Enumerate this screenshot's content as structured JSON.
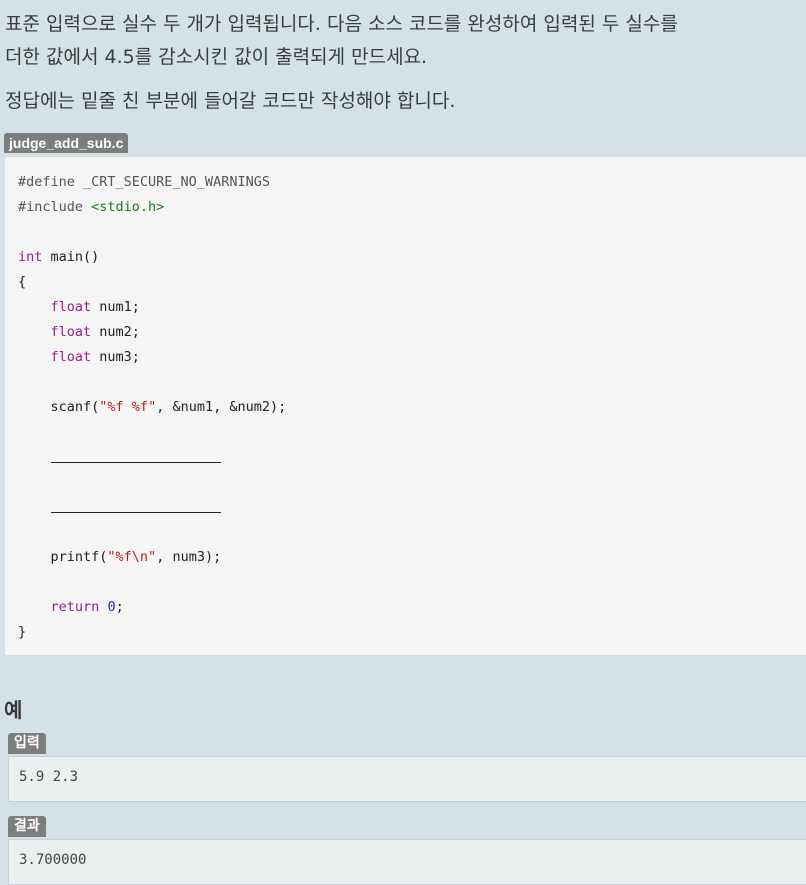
{
  "description": {
    "line1": "표준 입력으로 실수 두 개가 입력됩니다. 다음 소스 코드를 완성하여 입력된 두 실수를",
    "line2": "더한 값에서 4.5를 감소시킨 값이 출력되게 만드세요.",
    "line3": "정답에는 밑줄 친 부분에 들어갈 코드만 작성해야 합니다."
  },
  "file": {
    "name": "judge_add_sub.c"
  },
  "code": {
    "define": "#define _CRT_SECURE_NO_WARNINGS",
    "include_directive": "#include ",
    "include_header": "<stdio.h>",
    "int_kw": "int",
    "main_sig": " main()",
    "open_brace": "{",
    "float_kw": "float",
    "num1_decl": " num1;",
    "num2_decl": " num2;",
    "num3_decl": " num3;",
    "scanf_fn": "scanf(",
    "scanf_fmt": "\"%f %f\"",
    "scanf_args": ", &num1, &num2);",
    "printf_fn": "printf(",
    "printf_fmt": "\"%f\\n\"",
    "printf_args": ", num3);",
    "return_kw": "return",
    "return_val": "0",
    "semicolon": ";",
    "close_brace": "}"
  },
  "example": {
    "heading": "예",
    "input_label": "입력",
    "input_value": "5.9 2.3",
    "output_label": "결과",
    "output_value": "3.700000"
  }
}
